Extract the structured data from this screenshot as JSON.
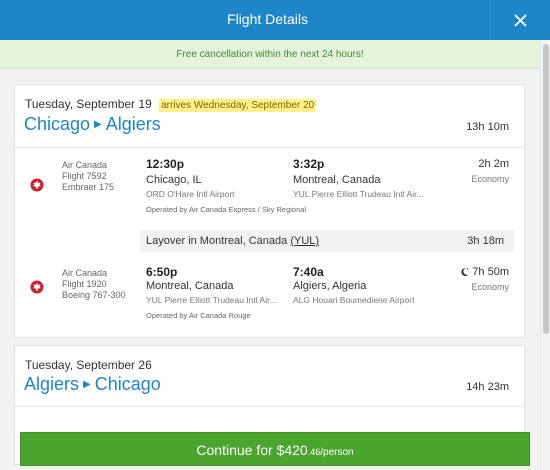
{
  "header": {
    "title": "Flight Details"
  },
  "banner": {
    "text": "Free cancellation within the next 24 hours!"
  },
  "trips": [
    {
      "date": "Tuesday, September 19",
      "arrives": "arrives Wednesday, September 20",
      "from": "Chicago",
      "to": "Algiers",
      "duration": "13h 10m",
      "segments": [
        {
          "airline": "Air Canada",
          "flight": "Flight 7592",
          "aircraft": "Embraer 175",
          "dep_time": "12:30p",
          "dep_city": "Chicago, IL",
          "dep_airport": "ORD O'Hare Intl Airport",
          "arr_time": "3:32p",
          "arr_city": "Montreal, Canada",
          "arr_airport": "YUL Pierre Elliott Trudeau Intl Air...",
          "operated": "Operated by Air Canada Express / Sky Regional",
          "duration": "2h 2m",
          "cabin": "Economy"
        },
        {
          "airline": "Air Canada",
          "flight": "Flight 1920",
          "aircraft": "Boeing 767-300",
          "dep_time": "6:50p",
          "dep_city": "Montreal, Canada",
          "dep_airport": "YUL Pierre Elliott Trudeau Intl Air...",
          "arr_time": "7:40a",
          "arr_city": "Algiers, Algeria",
          "arr_airport": "ALG Houari Boumediene Airport",
          "operated": "Operated by Air Canada Rouge",
          "duration": "7h 50m",
          "cabin": "Economy"
        }
      ],
      "layover": {
        "text": "Layover in Montreal, Canada",
        "code": "(YUL)",
        "duration": "3h 18m"
      }
    },
    {
      "date": "Tuesday, September 26",
      "from": "Algiers",
      "to": "Chicago",
      "duration": "14h 23m"
    }
  ],
  "continue": {
    "label": "Continue for ",
    "price": "$420",
    "cents": ".46",
    "per": "/person"
  },
  "colors": {
    "header": "#1d86c9",
    "accent_blue": "#1d86c9",
    "banner_text": "#3a8c2e",
    "button": "#4aa52e",
    "highlight": "#fff08a"
  }
}
